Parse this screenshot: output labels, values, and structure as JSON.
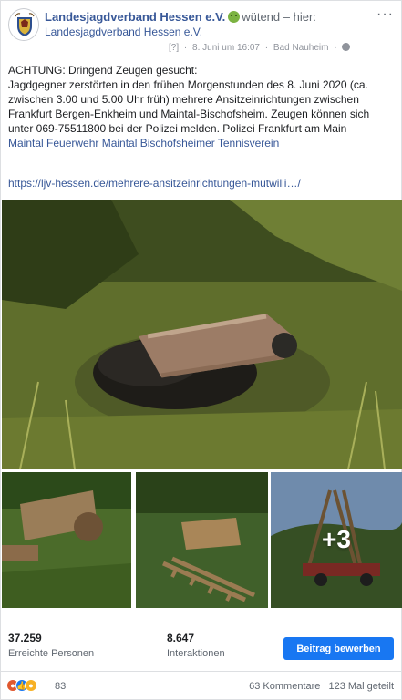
{
  "post": {
    "page_name": "Landesjagdverband Hessen e.V.",
    "feeling": "wütend – hier:",
    "feeling_target": "Landesjagdverband Hessen e.V.",
    "meta_icon": "[?]",
    "date": "8. Juni um 16:07",
    "location": "Bad Nauheim",
    "menu": "···",
    "text_heading": "ACHTUNG: Dringend Zeugen gesucht:",
    "text_body": "Jagdgegner zerstörten in den frühen Morgenstunden des 8. Juni 2020 (ca. zwischen 3.00 und 5.00 Uhr früh) mehrere Ansitzeinrichtungen zwischen Frankfurt Bergen-Enkheim und Maintal-Bischofsheim. Zeugen können sich unter 069-75511800 bei der Polizei melden. Polizei Frankfurt am Main",
    "tags": "Maintal Feuerwehr Maintal Bischofsheimer Tennisverein",
    "link": "https://ljv-hessen.de/mehrere-ansitzeinrichtungen-mutwilli…/"
  },
  "photos": {
    "more_count": "+3"
  },
  "stats": {
    "reach_value": "37.259",
    "reach_label": "Erreichte Personen",
    "interactions_value": "8.647",
    "interactions_label": "Interaktionen",
    "boost_label": "Beitrag bewerben"
  },
  "footer": {
    "reaction_count": "83",
    "comments": "63 Kommentare",
    "shares": "123 Mal geteilt"
  },
  "icons": [
    "page-avatar-crest",
    "sick-emoji-icon",
    "globe-icon",
    "angry-reaction-icon",
    "like-reaction-icon",
    "haha-reaction-icon"
  ],
  "colors": {
    "link": "#385898",
    "button": "#1877f2",
    "muted": "#606770"
  }
}
